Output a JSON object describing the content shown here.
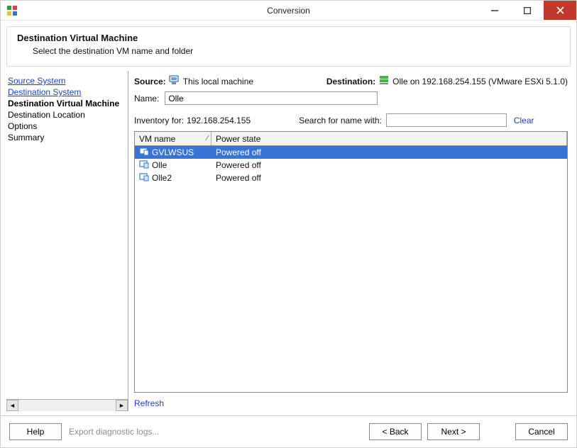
{
  "window": {
    "title": "Conversion"
  },
  "header": {
    "title": "Destination Virtual Machine",
    "subtitle": "Select the destination VM name and folder"
  },
  "sidebar": {
    "steps": [
      {
        "label": "Source System",
        "state": "done"
      },
      {
        "label": "Destination System",
        "state": "done"
      },
      {
        "label": "Destination Virtual Machine",
        "state": "current"
      },
      {
        "label": "Destination Location",
        "state": "future"
      },
      {
        "label": "Options",
        "state": "future"
      },
      {
        "label": "Summary",
        "state": "future"
      }
    ]
  },
  "main": {
    "source_label": "Source:",
    "source_text": "This local machine",
    "dest_label": "Destination:",
    "dest_text": "Olle on 192.168.254.155 (VMware ESXi 5.1.0)",
    "name_label": "Name:",
    "name_value": "Olle",
    "inventory_label": "Inventory for:",
    "inventory_host": "192.168.254.155",
    "search_label": "Search for name with:",
    "search_value": "",
    "clear_label": "Clear",
    "table": {
      "col_name": "VM name",
      "col_state": "Power state",
      "rows": [
        {
          "name": "GVLWSUS",
          "state": "Powered off",
          "selected": true
        },
        {
          "name": "Olle",
          "state": "Powered off",
          "selected": false
        },
        {
          "name": "Olle2",
          "state": "Powered off",
          "selected": false
        }
      ]
    },
    "refresh_label": "Refresh"
  },
  "footer": {
    "help": "Help",
    "export": "Export diagnostic logs...",
    "back": "< Back",
    "next": "Next >",
    "cancel": "Cancel"
  }
}
